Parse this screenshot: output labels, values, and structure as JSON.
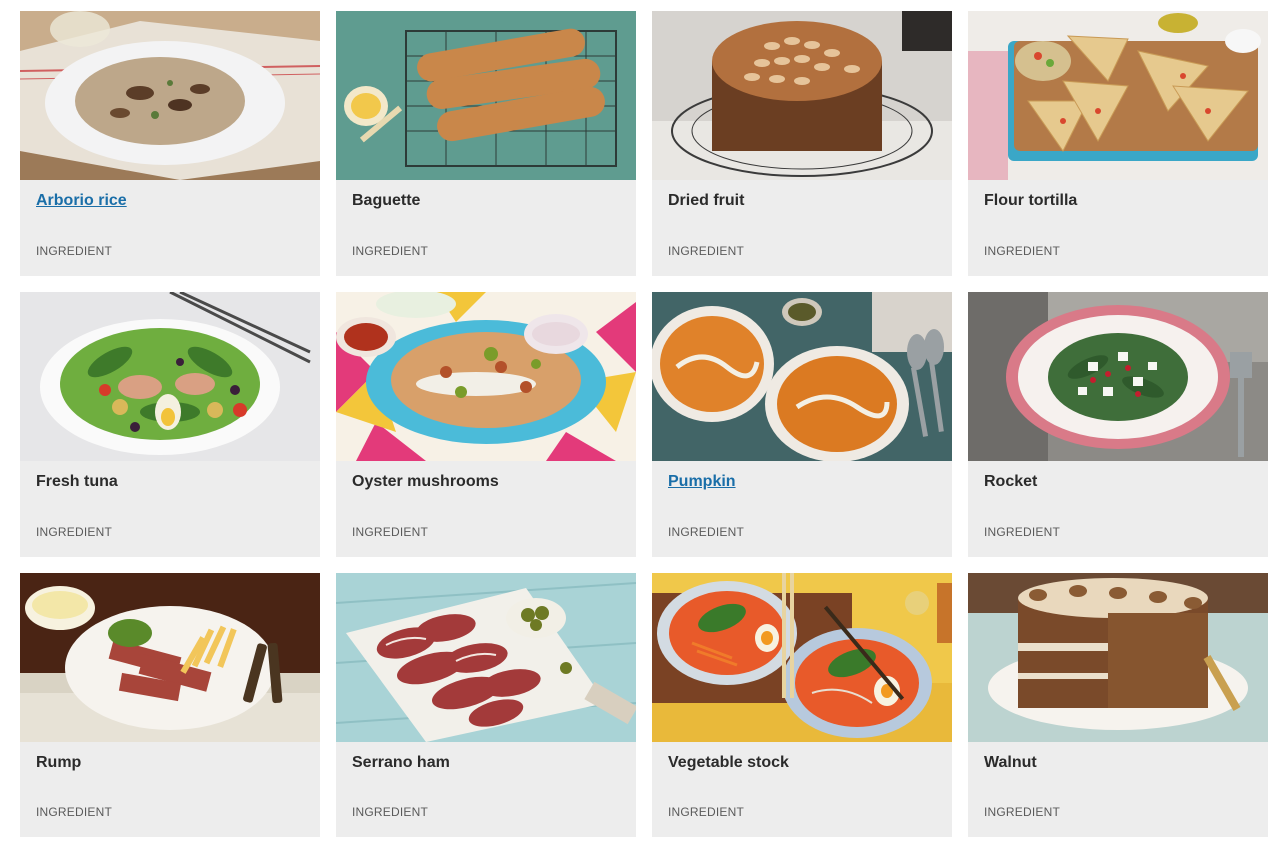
{
  "cards": [
    {
      "title": "Arborio rice",
      "type": "INGREDIENT",
      "image": "risotto-bowl"
    },
    {
      "title": "Baguette",
      "type": "INGREDIENT",
      "image": "baguettes-on-rack"
    },
    {
      "title": "Dried fruit",
      "type": "INGREDIENT",
      "image": "fruit-cake"
    },
    {
      "title": "Flour tortilla",
      "type": "INGREDIENT",
      "image": "quesadillas-board"
    },
    {
      "title": "Fresh tuna",
      "type": "INGREDIENT",
      "image": "nicoise-salad"
    },
    {
      "title": "Oyster mushrooms",
      "type": "INGREDIENT",
      "image": "pitta-wraps"
    },
    {
      "title": "Pumpkin",
      "type": "INGREDIENT",
      "image": "pumpkin-soup"
    },
    {
      "title": "Rocket",
      "type": "INGREDIENT",
      "image": "rocket-salad"
    },
    {
      "title": "Rump",
      "type": "INGREDIENT",
      "image": "steak-chips"
    },
    {
      "title": "Serrano ham",
      "type": "INGREDIENT",
      "image": "ham-board"
    },
    {
      "title": "Vegetable stock",
      "type": "INGREDIENT",
      "image": "ramen-bowls"
    },
    {
      "title": "Walnut",
      "type": "INGREDIENT",
      "image": "coffee-walnut-cake"
    }
  ]
}
